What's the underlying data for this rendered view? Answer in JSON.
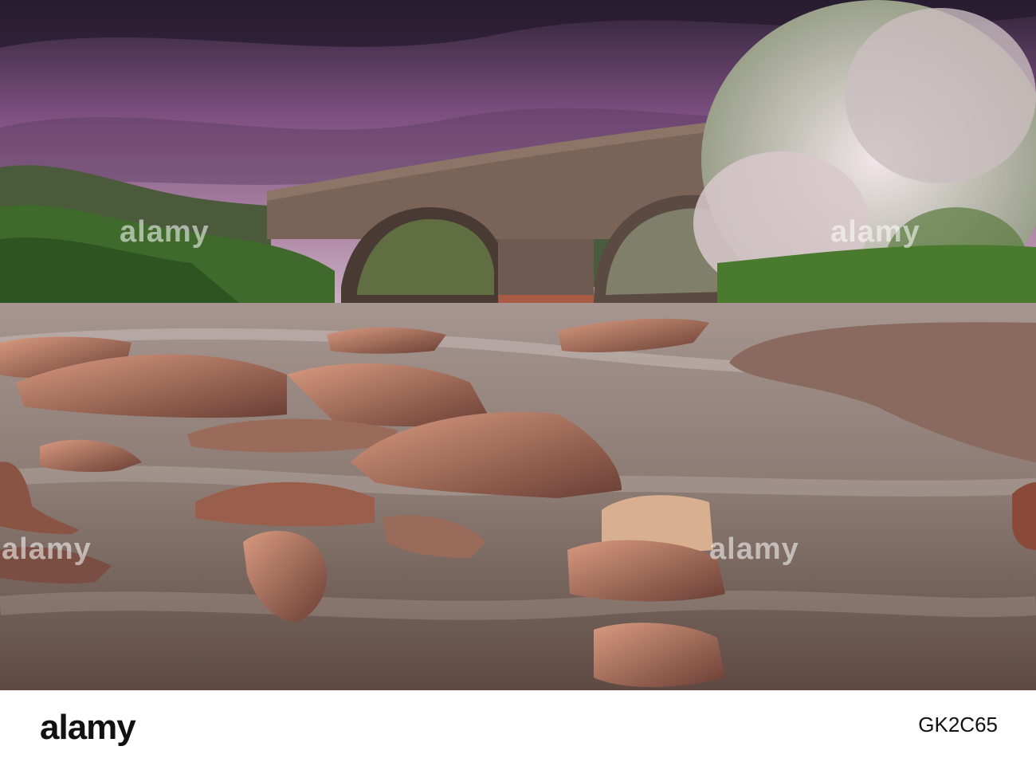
{
  "photo": {
    "subject": "stone-arch-bridge-river",
    "colors": {
      "sky_top": "#3a2a45",
      "sky_mid": "#8a5a8a",
      "sky_low": "#c9a6c0",
      "hills": "#4a5a3a",
      "bridge": "#7a6458",
      "water": "#8a7e78",
      "rock": "#a86a55",
      "tree_blossom": "#e6d6dc",
      "foliage": "#3e6a2a"
    }
  },
  "watermarks": {
    "wm1": "alamy",
    "wm2": "alamy",
    "wm3": "alamy",
    "wm4": "alamy"
  },
  "footer": {
    "logo": "alamy",
    "image_id": "GK2C65"
  }
}
